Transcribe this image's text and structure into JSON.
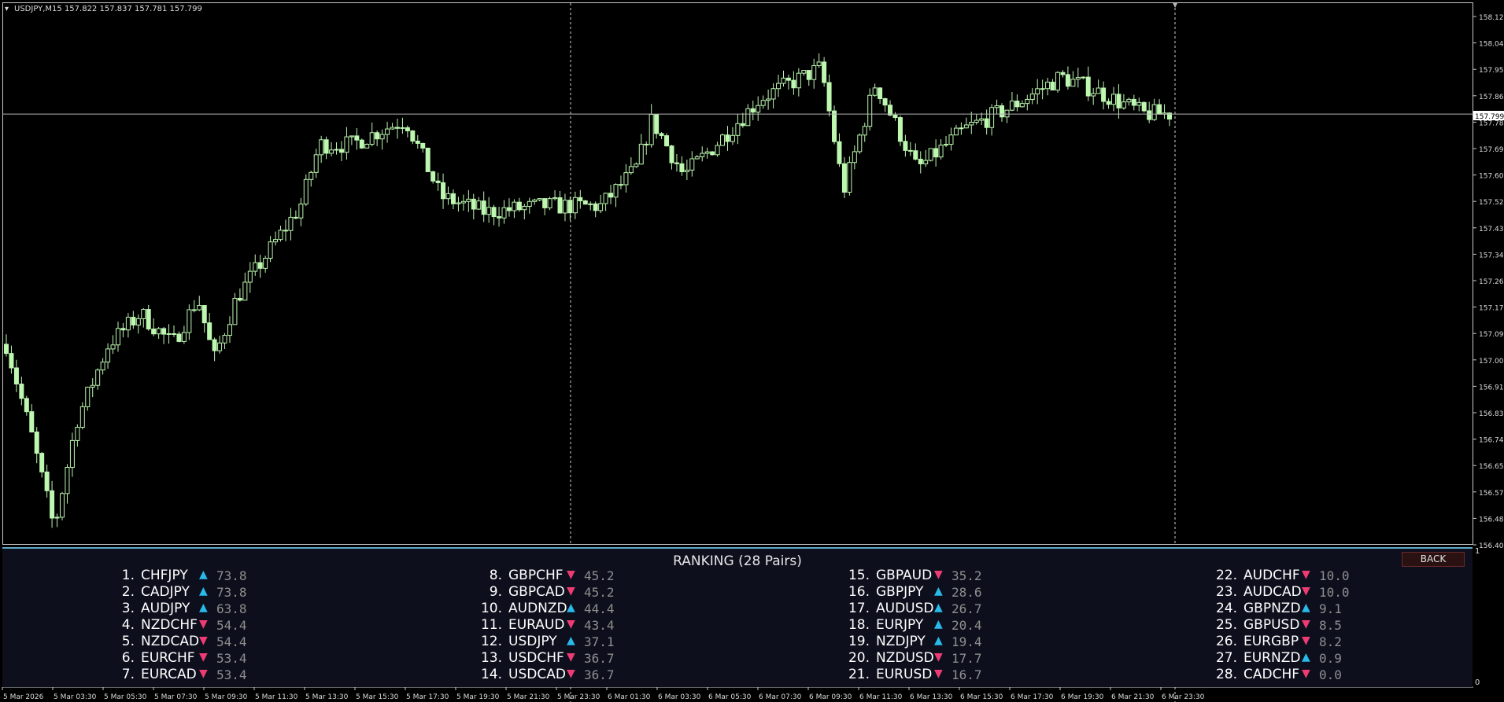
{
  "header": {
    "symbol_info": "USDJPY,M15  157.822 157.837 157.781 157.799"
  },
  "price_axis": {
    "ticks": [
      "158.125",
      "158.040",
      "157.950",
      "157.865",
      "157.780",
      "157.690",
      "157.605",
      "157.520",
      "157.435",
      "157.345",
      "157.260",
      "157.175",
      "157.090",
      "157.000",
      "156.915",
      "156.830",
      "156.745",
      "156.655",
      "156.570",
      "156.485",
      "156.400"
    ],
    "current_price": "157.799"
  },
  "indicator_axis": {
    "top": "1",
    "bottom": "0"
  },
  "time_axis": {
    "ticks": [
      "5 Mar 2026",
      "5 Mar 03:30",
      "5 Mar 05:30",
      "5 Mar 07:30",
      "5 Mar 09:30",
      "5 Mar 11:30",
      "5 Mar 13:30",
      "5 Mar 15:30",
      "5 Mar 17:30",
      "5 Mar 19:30",
      "5 Mar 21:30",
      "5 Mar 23:30",
      "6 Mar 01:30",
      "6 Mar 03:30",
      "6 Mar 05:30",
      "6 Mar 07:30",
      "6 Mar 09:30",
      "6 Mar 11:30",
      "6 Mar 13:30",
      "6 Mar 15:30",
      "6 Mar 17:30",
      "6 Mar 19:30",
      "6 Mar 21:30",
      "6 Mar 23:30"
    ]
  },
  "chart_data": {
    "type": "candlestick",
    "symbol": "USDJPY",
    "timeframe": "M15",
    "ylim": [
      156.4,
      158.16
    ],
    "candle_count": 230,
    "current_price": 157.799,
    "colors": {
      "candle": "#bdf7b0",
      "background": "#000000",
      "grid": "#ffffff"
    }
  },
  "ranking": {
    "title": "RANKING (28 Pairs)",
    "back_label": "BACK",
    "items": [
      {
        "num": "1.",
        "pair": "CHFJPY",
        "dir": "up",
        "score": "73.8"
      },
      {
        "num": "2.",
        "pair": "CADJPY",
        "dir": "up",
        "score": "73.8"
      },
      {
        "num": "3.",
        "pair": "AUDJPY",
        "dir": "up",
        "score": "63.8"
      },
      {
        "num": "4.",
        "pair": "NZDCHF",
        "dir": "down",
        "score": "54.4"
      },
      {
        "num": "5.",
        "pair": "NZDCAD",
        "dir": "down",
        "score": "54.4"
      },
      {
        "num": "6.",
        "pair": "EURCHF",
        "dir": "down",
        "score": "53.4"
      },
      {
        "num": "7.",
        "pair": "EURCAD",
        "dir": "down",
        "score": "53.4"
      },
      {
        "num": "8.",
        "pair": "GBPCHF",
        "dir": "down",
        "score": "45.2"
      },
      {
        "num": "9.",
        "pair": "GBPCAD",
        "dir": "down",
        "score": "45.2"
      },
      {
        "num": "10.",
        "pair": "AUDNZD",
        "dir": "up",
        "score": "44.4"
      },
      {
        "num": "11.",
        "pair": "EURAUD",
        "dir": "down",
        "score": "43.4"
      },
      {
        "num": "12.",
        "pair": "USDJPY",
        "dir": "up",
        "score": "37.1"
      },
      {
        "num": "13.",
        "pair": "USDCHF",
        "dir": "down",
        "score": "36.7"
      },
      {
        "num": "14.",
        "pair": "USDCAD",
        "dir": "down",
        "score": "36.7"
      },
      {
        "num": "15.",
        "pair": "GBPAUD",
        "dir": "down",
        "score": "35.2"
      },
      {
        "num": "16.",
        "pair": "GBPJPY",
        "dir": "up",
        "score": "28.6"
      },
      {
        "num": "17.",
        "pair": "AUDUSD",
        "dir": "up",
        "score": "26.7"
      },
      {
        "num": "18.",
        "pair": "EURJPY",
        "dir": "up",
        "score": "20.4"
      },
      {
        "num": "19.",
        "pair": "NZDJPY",
        "dir": "up",
        "score": "19.4"
      },
      {
        "num": "20.",
        "pair": "NZDUSD",
        "dir": "down",
        "score": "17.7"
      },
      {
        "num": "21.",
        "pair": "EURUSD",
        "dir": "down",
        "score": "16.7"
      },
      {
        "num": "22.",
        "pair": "AUDCHF",
        "dir": "down",
        "score": "10.0"
      },
      {
        "num": "23.",
        "pair": "AUDCAD",
        "dir": "down",
        "score": "10.0"
      },
      {
        "num": "24.",
        "pair": "GBPNZD",
        "dir": "up",
        "score": "9.1"
      },
      {
        "num": "25.",
        "pair": "GBPUSD",
        "dir": "down",
        "score": "8.5"
      },
      {
        "num": "26.",
        "pair": "EURGBP",
        "dir": "down",
        "score": "8.2"
      },
      {
        "num": "27.",
        "pair": "EURNZD",
        "dir": "up",
        "score": "0.9"
      },
      {
        "num": "28.",
        "pair": "CADCHF",
        "dir": "down",
        "score": "0.0"
      }
    ],
    "arrows": {
      "up": "▲",
      "down": "▼"
    }
  }
}
